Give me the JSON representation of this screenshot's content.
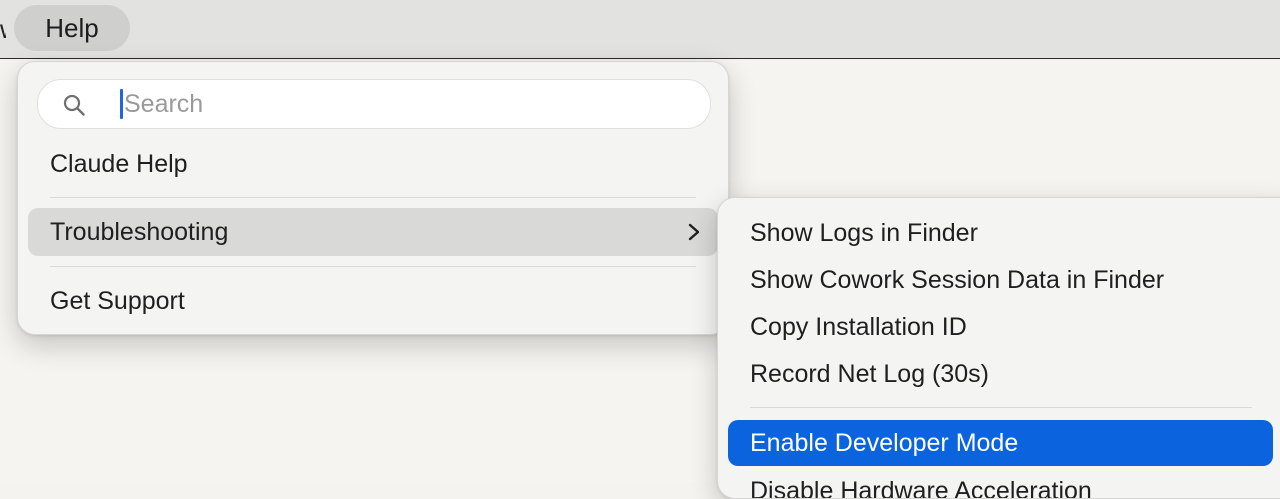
{
  "menubar": {
    "partial_item": "w",
    "help_label": "Help"
  },
  "help_menu": {
    "search": {
      "placeholder": "Search",
      "value": ""
    },
    "items": [
      {
        "label": "Claude Help"
      },
      {
        "label": "Troubleshooting",
        "has_submenu": true
      },
      {
        "label": "Get Support"
      }
    ]
  },
  "troubleshooting_submenu": {
    "items": [
      {
        "label": "Show Logs in Finder"
      },
      {
        "label": "Show Cowork Session Data in Finder"
      },
      {
        "label": "Copy Installation ID"
      },
      {
        "label": "Record Net Log (30s)"
      },
      {
        "label": "Enable Developer Mode"
      },
      {
        "label": "Disable Hardware Acceleration"
      }
    ]
  },
  "colors": {
    "selection_blue": "#0b63dd",
    "caret_blue": "#2364e0"
  },
  "icons": {
    "search": "search-icon",
    "submenu_arrow": "chevron-right-icon"
  }
}
